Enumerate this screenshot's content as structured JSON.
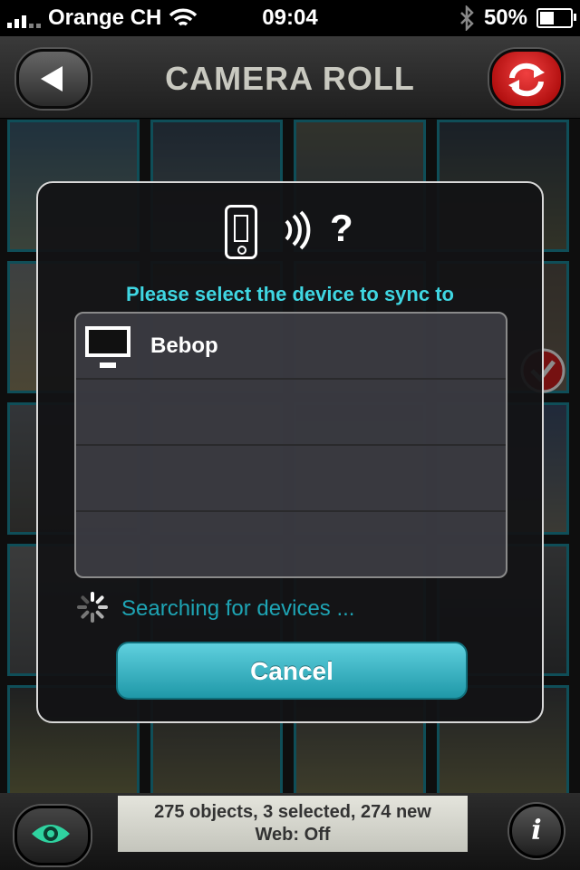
{
  "status_bar": {
    "carrier": "Orange CH",
    "time": "09:04",
    "battery": "50%",
    "battery_level": 0.5,
    "icons": [
      "signal-icon",
      "wifi-icon",
      "bluetooth-icon",
      "battery-icon"
    ]
  },
  "nav": {
    "title": "CAMERA ROLL",
    "back_icon": "back-arrow-icon",
    "sync_icon": "refresh-icon"
  },
  "dialog": {
    "icons": [
      "phone-icon",
      "wireless-waves-icon",
      "question-icon"
    ],
    "question_mark": "?",
    "prompt": "Please select the device to sync to",
    "devices": [
      {
        "name": "Bebop",
        "icon": "monitor-icon"
      },
      {
        "name": ""
      },
      {
        "name": ""
      },
      {
        "name": ""
      }
    ],
    "searching_text": "Searching for devices ...",
    "cancel_label": "Cancel"
  },
  "bottom": {
    "status_line1": "275 objects, 3 selected, 274 new",
    "status_line2": "Web: Off",
    "info_label": "i",
    "eye_icon": "eye-icon"
  },
  "colors": {
    "accent": "#3fd6e2",
    "thumb_border": "#1d8fa0",
    "sync_red": "#d81818",
    "eye_green": "#2fd3a0"
  }
}
